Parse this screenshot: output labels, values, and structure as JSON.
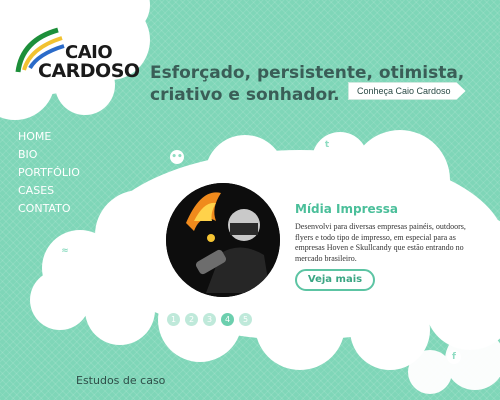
{
  "brand": {
    "line1": "CAIO",
    "line2": "CARDOSO"
  },
  "tagline": "Esforçado, persistente, otimista, criativo e sonhador.",
  "cta_label": "Conheça Caio Cardoso",
  "nav": {
    "items": [
      {
        "label": "HOME"
      },
      {
        "label": "BIO"
      },
      {
        "label": "PORTFÓLIO"
      },
      {
        "label": "CASES"
      },
      {
        "label": "CONTATO"
      }
    ]
  },
  "feature": {
    "title": "Mídia Impressa",
    "description": "Desenvolvi para diversas empresas painéis, outdoors, flyers e todo tipo de impresso, em especial para as empresas Hoven e Skullcandy que estão entrando no mercado brasileiro.",
    "button_label": "Veja mais"
  },
  "pager": {
    "pages": [
      "1",
      "2",
      "3",
      "4",
      "5"
    ],
    "active_page": "4"
  },
  "section_title": "Estudos de caso",
  "icons": {
    "twitter": "twitter-icon",
    "flickr": "flickr-icon",
    "shoe": "shoe-icon",
    "facebook": "facebook-icon"
  },
  "colors": {
    "background": "#7fd6b8",
    "accent": "#4bbf9a",
    "cloud": "#ffffff",
    "text_dark": "#3a5e57"
  }
}
